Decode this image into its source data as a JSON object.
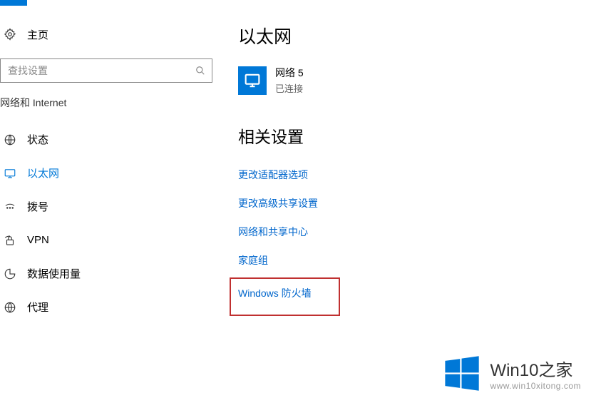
{
  "sidebar": {
    "home_label": "主页",
    "search_placeholder": "查找设置",
    "category": "网络和 Internet",
    "items": [
      {
        "label": "状态"
      },
      {
        "label": "以太网"
      },
      {
        "label": "拨号"
      },
      {
        "label": "VPN"
      },
      {
        "label": "数据使用量"
      },
      {
        "label": "代理"
      }
    ]
  },
  "main": {
    "title": "以太网",
    "network": {
      "name": "网络  5",
      "status": "已连接"
    },
    "related_title": "相关设置",
    "links": [
      "更改适配器选项",
      "更改高级共享设置",
      "网络和共享中心",
      "家庭组",
      "Windows 防火墙"
    ]
  },
  "watermark": {
    "title": "Win10之家",
    "url": "www.win10xitong.com"
  }
}
